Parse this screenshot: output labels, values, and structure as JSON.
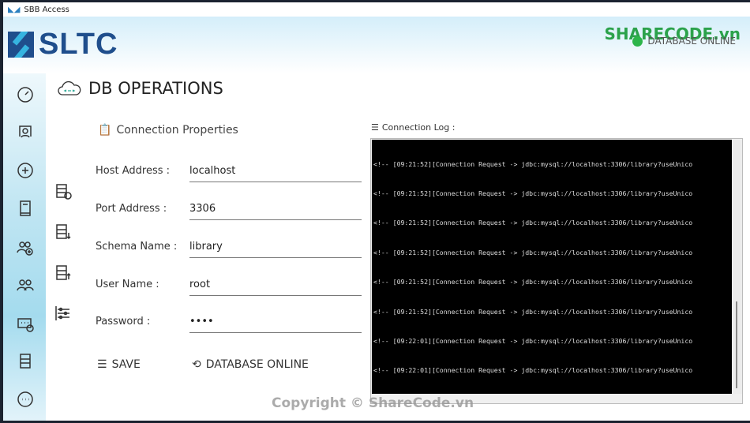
{
  "window": {
    "title": "SBB Access"
  },
  "header": {
    "logo_text": "SLTC",
    "status": "DATABASE ONLINE",
    "status_color": "#2db54a",
    "watermark": "SHARECODE.vn"
  },
  "page": {
    "title": "DB OPERATIONS",
    "section": "Connection Properties"
  },
  "form": {
    "host_label": "Host Address :",
    "host": "localhost",
    "port_label": "Port Address :",
    "port": "3306",
    "schema_label": "Schema Name :",
    "schema": "library",
    "user_label": "User Name :",
    "user": "root",
    "password_label": "Password :",
    "password": "••••"
  },
  "buttons": {
    "save": "SAVE",
    "db_online": "DATABASE ONLINE"
  },
  "log": {
    "label": "Connection Log :",
    "lines": [
      "<!-- [09:21:52][Connection Request -> jdbc:mysql://localhost:3306/library?useUnico",
      "<!-- [09:21:52][Connection Request -> jdbc:mysql://localhost:3306/library?useUnico",
      "<!-- [09:21:52][Connection Request -> jdbc:mysql://localhost:3306/library?useUnico",
      "<!-- [09:21:52][Connection Request -> jdbc:mysql://localhost:3306/library?useUnico",
      "<!-- [09:21:52][Connection Request -> jdbc:mysql://localhost:3306/library?useUnico",
      "<!-- [09:21:52][Connection Request -> jdbc:mysql://localhost:3306/library?useUnico",
      "<!-- [09:22:01][Connection Request -> jdbc:mysql://localhost:3306/library?useUnico",
      "<!-- [09:22:01][Connection Request -> jdbc:mysql://localhost:3306/library?useUnico"
    ]
  },
  "footer": "Copyright © ShareCode.vn"
}
